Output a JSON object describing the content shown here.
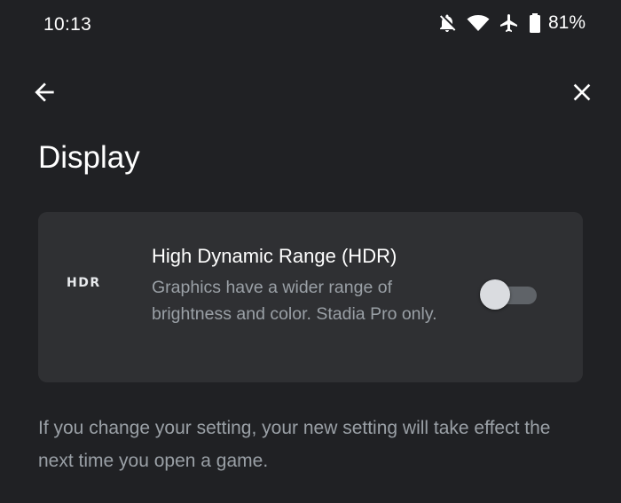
{
  "status_bar": {
    "time": "10:13",
    "battery_percent": "81%",
    "icons": [
      "notifications-off-icon",
      "wifi-icon",
      "airplane-mode-icon",
      "battery-icon"
    ]
  },
  "app_bar": {
    "back_icon": "arrow-back-icon",
    "close_icon": "close-icon"
  },
  "page": {
    "title": "Display"
  },
  "setting": {
    "icon_label": "HDR",
    "title": "High Dynamic Range (HDR)",
    "description": "Graphics have a wider range of brightness and color. Stadia Pro only.",
    "enabled": false
  },
  "footnote": "If you change your setting, your new setting will take effect the next time you open a game.",
  "colors": {
    "background": "#202124",
    "card": "#2f3033",
    "text_primary": "#ffffff",
    "text_secondary": "#9aa0a6"
  }
}
